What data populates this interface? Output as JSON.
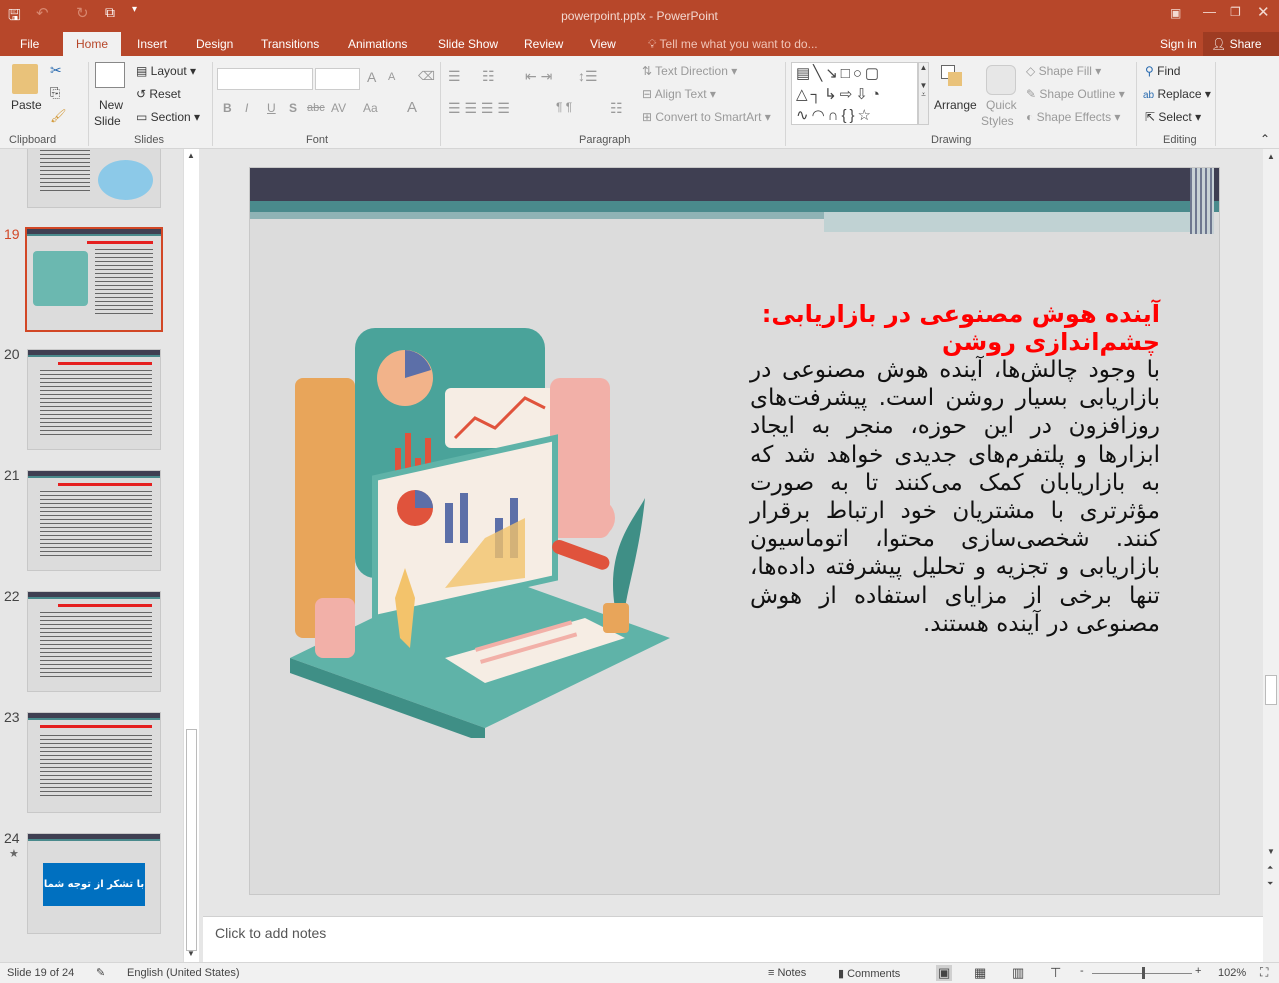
{
  "window": {
    "title": "powerpoint.pptx - PowerPoint"
  },
  "quick_access": [
    "save-icon",
    "undo-icon",
    "redo-icon",
    "start-from-beginning-icon",
    "customize-icon"
  ],
  "tabs": [
    "File",
    "Home",
    "Insert",
    "Design",
    "Transitions",
    "Animations",
    "Slide Show",
    "Review",
    "View"
  ],
  "active_tab": "Home",
  "tell_me": "Tell me what you want to do...",
  "sign_in": "Sign in",
  "share": "Share",
  "ribbon": {
    "clipboard": {
      "paste": "Paste",
      "group": "Clipboard"
    },
    "slides": {
      "new_slide_1": "New",
      "new_slide_2": "Slide",
      "layout": "Layout",
      "reset": "Reset",
      "section": "Section",
      "group": "Slides"
    },
    "font": {
      "group": "Font",
      "bold": "B",
      "italic": "I",
      "underline": "U",
      "shadow": "S",
      "strike": "abc",
      "spacing": "AV",
      "case": "Aa",
      "color": "A",
      "grow": "A",
      "shrink": "A"
    },
    "paragraph": {
      "group": "Paragraph",
      "text_direction": "Text Direction",
      "align_text": "Align Text",
      "convert_smartart": "Convert to SmartArt"
    },
    "drawing": {
      "group": "Drawing",
      "arrange": "Arrange",
      "quick_styles_1": "Quick",
      "quick_styles_2": "Styles",
      "shape_fill": "Shape Fill",
      "shape_outline": "Shape Outline",
      "shape_effects": "Shape Effects"
    },
    "editing": {
      "group": "Editing",
      "find": "Find",
      "replace": "Replace",
      "select": "Select"
    }
  },
  "thumbnails": [
    {
      "number": "19",
      "selected": true
    },
    {
      "number": "20"
    },
    {
      "number": "21"
    },
    {
      "number": "22"
    },
    {
      "number": "23"
    },
    {
      "number": "24",
      "text": "با تشکر از توجه شما",
      "box_color": "#0070c0"
    }
  ],
  "slide": {
    "title": "آینده هوش مصنوعی در بازاریابی: چشم‌اندازی روشن",
    "body": "با وجود چالش‌ها، آینده هوش مصنوعی در بازاریابی بسیار روشن است. پیشرفت‌های روزافزون در این حوزه، منجر به ایجاد ابزارها و پلتفرم‌های جدیدی خواهد شد که به بازاریابان کمک می‌کنند تا به صورت مؤثرتری با مشتریان خود ارتباط برقرار کنند. شخصی‌سازی محتوا، اتوماسیون بازاریابی و تجزیه و تحلیل پیشرفته داده‌ها، تنها برخی از مزایای استفاده از هوش مصنوعی در آینده هستند.",
    "title_color": "#ff0000"
  },
  "notes": {
    "placeholder": "Click to add notes"
  },
  "status": {
    "slide": "Slide 19 of 24",
    "language": "English (United States)",
    "notes": "Notes",
    "comments": "Comments",
    "zoom": "102%",
    "zoom_fraction": 0.51
  },
  "colors": {
    "accent": "#b7472a",
    "header_dark": "#3f3f52",
    "teal": "#4a8a8c"
  }
}
